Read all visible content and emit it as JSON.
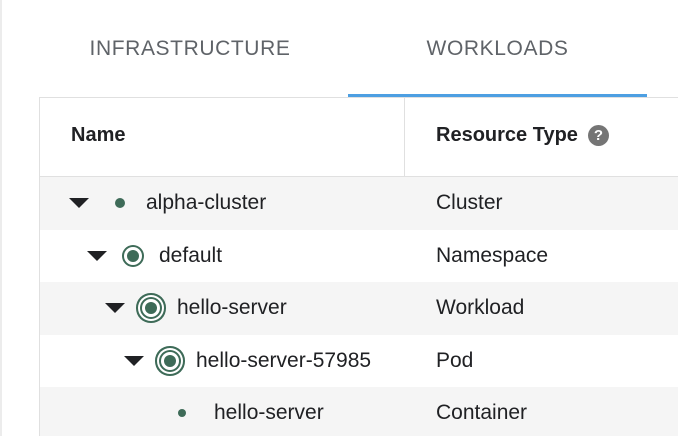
{
  "tabs": [
    {
      "label": "INFRASTRUCTURE",
      "selected": false
    },
    {
      "label": "WORKLOADS",
      "selected": true
    }
  ],
  "table": {
    "columns": {
      "name": "Name",
      "resource_type": "Resource Type",
      "help_icon": "?"
    },
    "rows": [
      {
        "name": "alpha-cluster",
        "type": "Cluster",
        "expanded": true,
        "status_icon": "status-dot-icon"
      },
      {
        "name": "default",
        "type": "Namespace",
        "expanded": true,
        "status_icon": "status-ring-icon"
      },
      {
        "name": "hello-server",
        "type": "Workload",
        "expanded": true,
        "status_icon": "status-double-ring-icon"
      },
      {
        "name": "hello-server-57985",
        "type": "Pod",
        "expanded": true,
        "status_icon": "status-double-ring-icon"
      },
      {
        "name": "hello-server",
        "type": "Container",
        "expanded": false,
        "status_icon": "status-dot-icon"
      }
    ]
  },
  "colors": {
    "accent": "#4d9fe2",
    "status": "#3e6b58",
    "row_shade": "#f5f5f5"
  }
}
